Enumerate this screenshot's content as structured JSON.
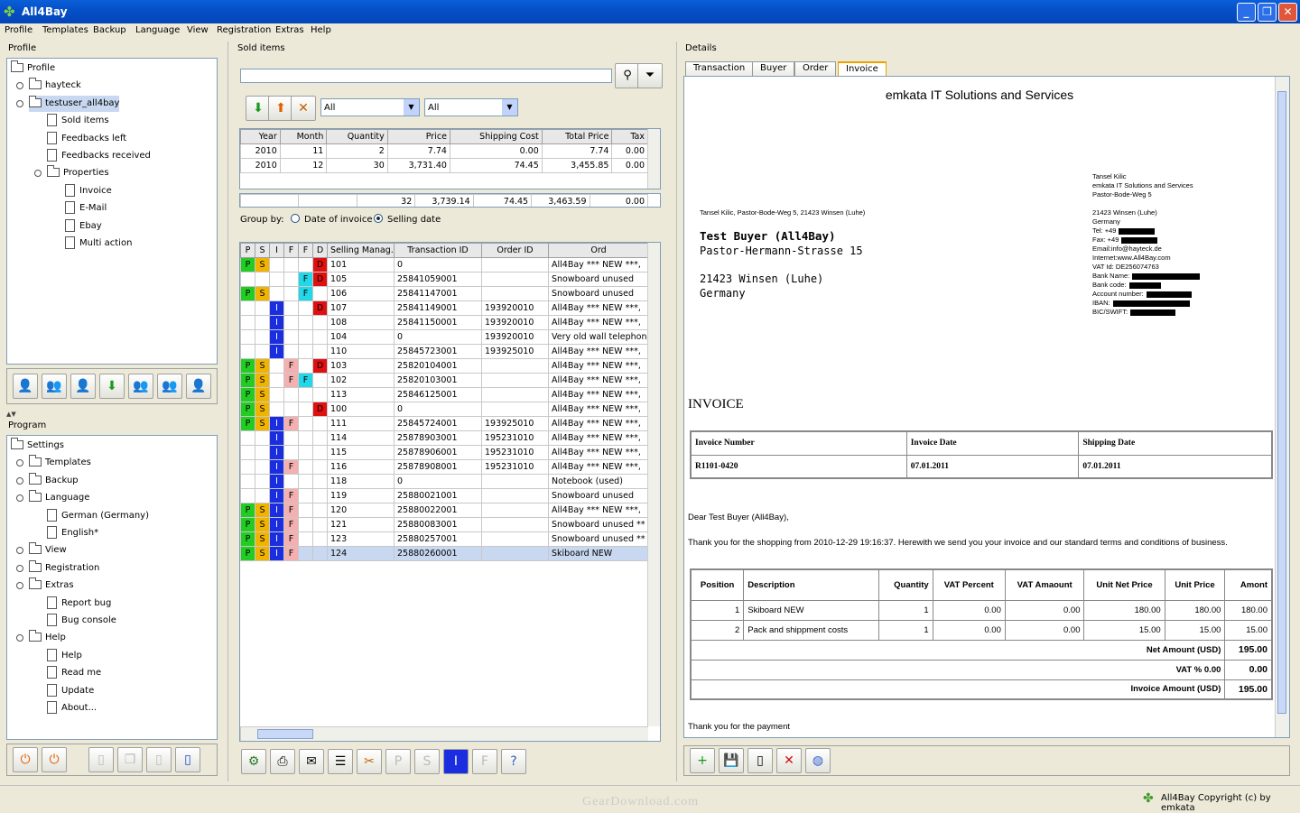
{
  "app": {
    "title": "All4Bay"
  },
  "menu": [
    "Profile",
    "Templates",
    "Backup",
    "Language",
    "View",
    "Registration",
    "Extras",
    "Help"
  ],
  "profile_panel": {
    "title": "Profile",
    "tree": [
      {
        "label": "Profile",
        "kind": "folder",
        "depth": 0
      },
      {
        "label": "hayteck",
        "kind": "folder",
        "depth": 1
      },
      {
        "label": "testuser_all4bay",
        "kind": "folder",
        "depth": 1,
        "selected": true
      },
      {
        "label": "Sold items",
        "kind": "doc",
        "depth": 2
      },
      {
        "label": "Feedbacks left",
        "kind": "doc",
        "depth": 2
      },
      {
        "label": "Feedbacks received",
        "kind": "doc",
        "depth": 2
      },
      {
        "label": "Properties",
        "kind": "folder",
        "depth": 2
      },
      {
        "label": "Invoice",
        "kind": "doc",
        "depth": 3
      },
      {
        "label": "E-Mail",
        "kind": "doc",
        "depth": 3
      },
      {
        "label": "Ebay",
        "kind": "doc",
        "depth": 3
      },
      {
        "label": "Multi action",
        "kind": "doc",
        "depth": 3
      }
    ]
  },
  "program_panel": {
    "title": "Program",
    "tree": [
      {
        "label": "Settings",
        "kind": "folder",
        "depth": 0
      },
      {
        "label": "Templates",
        "kind": "folder",
        "depth": 1
      },
      {
        "label": "Backup",
        "kind": "folder",
        "depth": 1
      },
      {
        "label": "Language",
        "kind": "folder",
        "depth": 1
      },
      {
        "label": "German (Germany)",
        "kind": "doc",
        "depth": 2
      },
      {
        "label": "English*",
        "kind": "doc",
        "depth": 2
      },
      {
        "label": "View",
        "kind": "folder",
        "depth": 1
      },
      {
        "label": "Registration",
        "kind": "folder",
        "depth": 1
      },
      {
        "label": "Extras",
        "kind": "folder",
        "depth": 1
      },
      {
        "label": "Report bug",
        "kind": "doc",
        "depth": 2
      },
      {
        "label": "Bug console",
        "kind": "doc",
        "depth": 2
      },
      {
        "label": "Help",
        "kind": "folder",
        "depth": 1
      },
      {
        "label": "Help",
        "kind": "doc",
        "depth": 2
      },
      {
        "label": "Read me",
        "kind": "doc",
        "depth": 2
      },
      {
        "label": "Update",
        "kind": "doc",
        "depth": 2
      },
      {
        "label": "About...",
        "kind": "doc",
        "depth": 2
      }
    ]
  },
  "sold": {
    "title": "Sold items",
    "filter1": "All",
    "filter2": "All",
    "summary_headers": [
      "Year",
      "Month",
      "Quantity",
      "Price",
      "Shipping Cost",
      "Total Price",
      "Tax"
    ],
    "summary_rows": [
      [
        "2010",
        "11",
        "2",
        "7.74",
        "0.00",
        "7.74",
        "0.00"
      ],
      [
        "2010",
        "12",
        "30",
        "3,731.40",
        "74.45",
        "3,455.85",
        "0.00"
      ]
    ],
    "summary_total": [
      "",
      "",
      "32",
      "3,739.14",
      "74.45",
      "3,463.59",
      "0.00"
    ],
    "group_by": "Group by:",
    "group_opt1": "Date of invoice",
    "group_opt2": "Selling date",
    "item_headers": [
      "P",
      "S",
      "I",
      "F",
      "F",
      "D",
      "Selling Manag...",
      "Transaction ID",
      "Order ID",
      "Ord"
    ],
    "items": [
      {
        "f": [
          "P",
          "S",
          "",
          "",
          "",
          "D"
        ],
        "sm": "101",
        "tid": "0",
        "oid": "",
        "title": "All4Bay *** NEW ***,"
      },
      {
        "f": [
          "",
          "",
          "",
          "",
          "F",
          "D"
        ],
        "sm": "105",
        "tid": "25841059001",
        "oid": "",
        "title": "Snowboard unused"
      },
      {
        "f": [
          "P",
          "S",
          "",
          "",
          "F",
          ""
        ],
        "sm": "106",
        "tid": "25841147001",
        "oid": "",
        "title": "Snowboard unused"
      },
      {
        "f": [
          "",
          "",
          "I",
          "",
          "",
          "D"
        ],
        "sm": "107",
        "tid": "25841149001",
        "oid": "193920010",
        "title": "All4Bay *** NEW ***,"
      },
      {
        "f": [
          "",
          "",
          "I",
          "",
          "",
          ""
        ],
        "sm": "108",
        "tid": "25841150001",
        "oid": "193920010",
        "title": "All4Bay *** NEW ***,"
      },
      {
        "f": [
          "",
          "",
          "I",
          "",
          "",
          ""
        ],
        "sm": "104",
        "tid": "0",
        "oid": "193920010",
        "title": "Very old wall telephone"
      },
      {
        "f": [
          "",
          "",
          "I",
          "",
          "",
          ""
        ],
        "sm": "110",
        "tid": "25845723001",
        "oid": "193925010",
        "title": "All4Bay *** NEW ***,"
      },
      {
        "f": [
          "P",
          "S",
          "",
          "F",
          "",
          "D"
        ],
        "sm": "103",
        "tid": "25820104001",
        "oid": "",
        "title": "All4Bay *** NEW ***,"
      },
      {
        "f": [
          "P",
          "S",
          "",
          "F",
          "F",
          ""
        ],
        "sm": "102",
        "tid": "25820103001",
        "oid": "",
        "title": "All4Bay *** NEW ***,"
      },
      {
        "f": [
          "P",
          "S",
          "",
          "",
          "",
          ""
        ],
        "sm": "113",
        "tid": "25846125001",
        "oid": "",
        "title": "All4Bay *** NEW ***,"
      },
      {
        "f": [
          "P",
          "S",
          "",
          "",
          "",
          "D"
        ],
        "sm": "100",
        "tid": "0",
        "oid": "",
        "title": "All4Bay *** NEW ***,"
      },
      {
        "f": [
          "P",
          "S",
          "I",
          "F",
          "",
          ""
        ],
        "sm": "111",
        "tid": "25845724001",
        "oid": "193925010",
        "title": "All4Bay *** NEW ***,"
      },
      {
        "f": [
          "",
          "",
          "I",
          "",
          "",
          ""
        ],
        "sm": "114",
        "tid": "25878903001",
        "oid": "195231010",
        "title": "All4Bay *** NEW ***,"
      },
      {
        "f": [
          "",
          "",
          "I",
          "",
          "",
          ""
        ],
        "sm": "115",
        "tid": "25878906001",
        "oid": "195231010",
        "title": "All4Bay *** NEW ***,"
      },
      {
        "f": [
          "",
          "",
          "I",
          "F",
          "",
          ""
        ],
        "sm": "116",
        "tid": "25878908001",
        "oid": "195231010",
        "title": "All4Bay *** NEW ***,"
      },
      {
        "f": [
          "",
          "",
          "I",
          "",
          "",
          ""
        ],
        "sm": "118",
        "tid": "0",
        "oid": "",
        "title": "Notebook (used)"
      },
      {
        "f": [
          "",
          "",
          "I",
          "F",
          "",
          ""
        ],
        "sm": "119",
        "tid": "25880021001",
        "oid": "",
        "title": "Snowboard unused"
      },
      {
        "f": [
          "P",
          "S",
          "I",
          "F",
          "",
          ""
        ],
        "sm": "120",
        "tid": "25880022001",
        "oid": "",
        "title": "All4Bay *** NEW ***,"
      },
      {
        "f": [
          "P",
          "S",
          "I",
          "F",
          "",
          ""
        ],
        "sm": "121",
        "tid": "25880083001",
        "oid": "",
        "title": "Snowboard unused **"
      },
      {
        "f": [
          "P",
          "S",
          "I",
          "F",
          "",
          ""
        ],
        "sm": "123",
        "tid": "25880257001",
        "oid": "",
        "title": "Snowboard unused **"
      },
      {
        "f": [
          "P",
          "S",
          "I",
          "F",
          "",
          ""
        ],
        "sm": "124",
        "tid": "25880260001",
        "oid": "",
        "title": "Skiboard NEW",
        "selected": true
      }
    ]
  },
  "details": {
    "title": "Details",
    "tabs": [
      "Transaction",
      "Buyer",
      "Order",
      "Invoice"
    ],
    "active_tab": "Invoice",
    "invoice": {
      "company": "emkata IT Solutions and Services",
      "sender_line": "Tansel Kilic, Pastor-Bode-Weg 5, 21423 Winsen (Luhe)",
      "seller": [
        "Tansel Kilic",
        "emkata IT Solutions and Services",
        "Pastor-Bode-Weg 5",
        "",
        "21423 Winsen (Luhe)",
        "Germany"
      ],
      "seller_contact": [
        {
          "k": "Tel: +49",
          "red": 40
        },
        {
          "k": "Fax: +49",
          "red": 40
        },
        {
          "k": "Email:info@hayteck.de",
          "red": 0
        },
        {
          "k": "Internet:www.All4Bay.com",
          "red": 0
        },
        {
          "k": "VAT  Id:  DE256074763",
          "red": 0
        },
        {
          "k": "Bank Name:",
          "red": 75
        },
        {
          "k": "Bank code:",
          "red": 35
        },
        {
          "k": "Account  number:",
          "red": 50
        },
        {
          "k": "IBAN:",
          "red": 85
        },
        {
          "k": "BIC/SWIFT:",
          "red": 50
        }
      ],
      "buyer_name": "Test Buyer (All4Bay)",
      "buyer_street": "Pastor-Hermann-Strasse 15",
      "buyer_city": "21423 Winsen (Luhe)",
      "buyer_country": "Germany",
      "heading": "INVOICE",
      "meta_headers": [
        "Invoice Number",
        "Invoice Date",
        "Shipping Date"
      ],
      "meta_values": [
        "R1101-0420",
        "07.01.2011",
        "07.01.2011"
      ],
      "greeting": "Dear Test Buyer (All4Bay),",
      "body": "Thank you for the shopping from 2010-12-29 19:16:37. Herewith we send you your invoice and our standard terms and conditions of business.",
      "item_headers": [
        "Position",
        "Description",
        "Quantity",
        "VAT Percent",
        "VAT Amaount",
        "Unit Net Price",
        "Unit Price",
        "Amont"
      ],
      "items": [
        [
          "1",
          "Skiboard NEW",
          "1",
          "0.00",
          "0.00",
          "180.00",
          "180.00",
          "180.00"
        ],
        [
          "2",
          "Pack and shippment costs",
          "1",
          "0.00",
          "0.00",
          "15.00",
          "15.00",
          "15.00"
        ]
      ],
      "net_label": "Net Amount (USD)",
      "net_value": "195.00",
      "vat_label": "VAT % 0.00",
      "vat_value": "0.00",
      "total_label": "Invoice Amount (USD)",
      "total_value": "195.00",
      "thanks": "Thank you for the payment"
    }
  },
  "status": {
    "copyright": "All4Bay Copyright (c) by emkata",
    "watermark": "GearDownload.com"
  }
}
